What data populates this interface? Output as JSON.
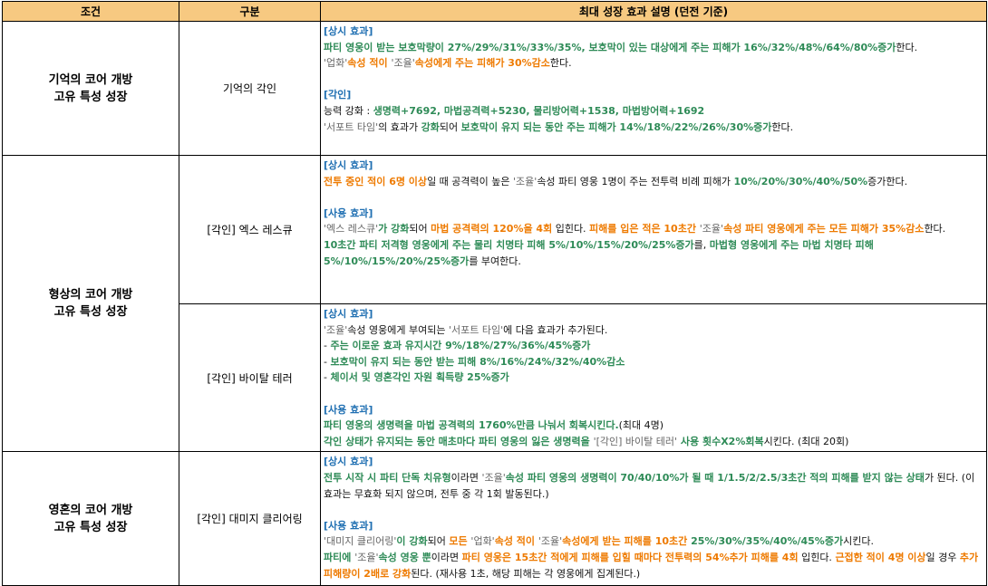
{
  "headers": [
    "조건",
    "구분",
    "최대 성장 효과 설명 (던전 기준)"
  ],
  "rows": [
    {
      "condition": [
        "기억의 코어 개방",
        "고유 특성 성장"
      ],
      "category": "기억의 각인",
      "paragraphs": [
        [
          {
            "c": "h",
            "t": "[상시 효과]"
          }
        ],
        [
          {
            "c": "g",
            "t": "파티 영웅이 받는 보호막량이 27%/29%/31%/33%/35%, 보호막이 있는 대상에게 주는 피해가 16%/32%/48%/64%/80%증가"
          },
          {
            "c": "k",
            "t": "한다."
          }
        ],
        [
          {
            "c": "gr",
            "t": "'업화'"
          },
          {
            "c": "o",
            "t": "속성 적이 "
          },
          {
            "c": "gr",
            "t": "'조율'"
          },
          {
            "c": "o",
            "t": "속성에게 주는 피해가 30%감소"
          },
          {
            "c": "k",
            "t": "한다."
          }
        ],
        [],
        [
          {
            "c": "h",
            "t": "[각인]"
          }
        ],
        [
          {
            "c": "k",
            "t": "능력 강화 : "
          },
          {
            "c": "g",
            "t": "생명력+7692, 마법공격력+5230, 물리방어력+1538, 마법방어력+1692"
          }
        ],
        [
          {
            "c": "gr",
            "t": "'서포트 타임'"
          },
          {
            "c": "k",
            "t": "의 효과가 "
          },
          {
            "c": "g",
            "t": "강화"
          },
          {
            "c": "k",
            "t": "되어 "
          },
          {
            "c": "g",
            "t": "보호막이 유지 되는 동안 주는 피해가 14%/18%/22%/26%/30%증가"
          },
          {
            "c": "k",
            "t": "한다."
          }
        ]
      ]
    },
    {
      "condition": [
        "형상의 코어 개방",
        "고유 특성 성장"
      ],
      "category": "[각인] 엑스 레스큐",
      "paragraphs": [
        [
          {
            "c": "h",
            "t": "[상시 효과]"
          }
        ],
        [
          {
            "c": "o",
            "t": "전투 중인 적이 6명 이상"
          },
          {
            "c": "k",
            "t": "일 때 공격력이 높은 "
          },
          {
            "c": "gr",
            "t": "'조율'"
          },
          {
            "c": "k",
            "t": "속성 파티 영웅 1명이 주는 전투력 비례 피해가 "
          },
          {
            "c": "g",
            "t": "10%/20%/30%/40%/50%"
          },
          {
            "c": "k",
            "t": "증가한다."
          }
        ],
        [],
        [
          {
            "c": "h",
            "t": "[사용 효과]"
          }
        ],
        [
          {
            "c": "gr",
            "t": "'엑스 레스큐'"
          },
          {
            "c": "g",
            "t": "가 강화"
          },
          {
            "c": "k",
            "t": "되어 "
          },
          {
            "c": "o",
            "t": "마법 공격력의 120%을 4회"
          },
          {
            "c": "k",
            "t": " 입힌다. "
          },
          {
            "c": "o",
            "t": "피해를 입은 적은 10초간 "
          },
          {
            "c": "gr",
            "t": "'조율'"
          },
          {
            "c": "o",
            "t": "속성 파티 영웅에게 주는 모든 피해가 35%감소"
          },
          {
            "c": "k",
            "t": "한다."
          }
        ],
        [
          {
            "c": "g",
            "t": "10초간 파티 저격형 영웅에게 주는 물리 치명타 피해 5%/10%/15%/20%/25%증가"
          },
          {
            "c": "k",
            "t": "를, "
          },
          {
            "c": "g",
            "t": "마법형 영웅에게 주는 마법 치명타 피해 5%/10%/15%/20%/25%증가"
          },
          {
            "c": "k",
            "t": "를 부여한다."
          }
        ]
      ]
    },
    {
      "condition": [],
      "category": "[각인] 바이탈 테러",
      "paragraphs": [
        [
          {
            "c": "h",
            "t": "[상시 효과]"
          }
        ],
        [
          {
            "c": "gr",
            "t": "'조율'"
          },
          {
            "c": "k",
            "t": "속성 영웅에게 부여되는 "
          },
          {
            "c": "gr",
            "t": "'서포트 타임'"
          },
          {
            "c": "k",
            "t": "에 다음 효과가 추가된다."
          }
        ],
        [
          {
            "c": "k",
            "t": "- "
          },
          {
            "c": "g",
            "t": "주는 이로운 효과 유지시간 9%/18%/27%/36%/45%증가"
          }
        ],
        [
          {
            "c": "k",
            "t": "- "
          },
          {
            "c": "g",
            "t": "보호막이 유지 되는 동안 받는 피해 8%/16%/24%/32%/40%감소"
          }
        ],
        [
          {
            "c": "k",
            "t": "- "
          },
          {
            "c": "g",
            "t": "체이서 및 영혼각인 자원 획득량 25%증가"
          }
        ],
        [],
        [
          {
            "c": "h",
            "t": "[사용 효과]"
          }
        ],
        [
          {
            "c": "g",
            "t": "파티 영웅의 생명력을 마법 공격력의 1760%만큼 나눠서 회복시킨다."
          },
          {
            "c": "k",
            "t": "(최대 4명)"
          }
        ],
        [
          {
            "c": "g",
            "t": "각인 상태가 유지되는 동안 매초마다 파티 영웅의 잃은 생명력을 "
          },
          {
            "c": "gr",
            "t": "'[각인] 바이탈 테러'"
          },
          {
            "c": "g",
            "t": " 사용 횟수X2%회복"
          },
          {
            "c": "k",
            "t": "시킨다. (최대 20회)"
          }
        ]
      ]
    },
    {
      "condition": [
        "영혼의 코어 개방",
        "고유 특성 성장"
      ],
      "category": "[각인] 대미지 클리어링",
      "paragraphs": [
        [
          {
            "c": "h",
            "t": "[상시 효과]"
          }
        ],
        [
          {
            "c": "g",
            "t": "전투 시작 시 파티 단독 치유형"
          },
          {
            "c": "k",
            "t": "이라면 "
          },
          {
            "c": "gr",
            "t": "'조율'"
          },
          {
            "c": "g",
            "t": "속성 파티 영웅의 생명력이 70/40/10%가 될 때 1/1.5/2/2.5/3초간 적의 피해를 받지 않는 상태"
          },
          {
            "c": "k",
            "t": "가 된다. (이 효과는 무효화 되지 않으며, 전투 중 각 1회 발동된다.)"
          }
        ],
        [],
        [
          {
            "c": "h",
            "t": "[사용 효과]"
          }
        ],
        [
          {
            "c": "gr",
            "t": "'대미지 클리어링'"
          },
          {
            "c": "g",
            "t": "이 강화"
          },
          {
            "c": "k",
            "t": "되어 "
          },
          {
            "c": "o",
            "t": "모든 "
          },
          {
            "c": "gr",
            "t": "'업화'"
          },
          {
            "c": "o",
            "t": "속성 적이 "
          },
          {
            "c": "gr",
            "t": "'조율'"
          },
          {
            "c": "o",
            "t": "속성에게 받는 피해를 10초간 "
          },
          {
            "c": "g",
            "t": "25%/30%/35%/40%/45%증가"
          },
          {
            "c": "k",
            "t": "시킨다."
          }
        ],
        [
          {
            "c": "g",
            "t": "파티에 "
          },
          {
            "c": "gr",
            "t": "'조율'"
          },
          {
            "c": "g",
            "t": "속성 영웅 뿐"
          },
          {
            "c": "k",
            "t": "이라면 "
          },
          {
            "c": "o",
            "t": "파티 영웅은 15초간 적에게 피해를 입힐 때마다 전투력의 54%추가 피해를 4회"
          },
          {
            "c": "k",
            "t": " 입힌다. "
          },
          {
            "c": "o",
            "t": "근접한 적이 4명 이상"
          },
          {
            "c": "k",
            "t": "일 경우 "
          },
          {
            "c": "o",
            "t": "추가 피해량이 2배로 강화"
          },
          {
            "c": "k",
            "t": "된다. (재사용 1초, 해당 피해는 각 영웅에게 집계된다.)"
          }
        ]
      ]
    }
  ]
}
